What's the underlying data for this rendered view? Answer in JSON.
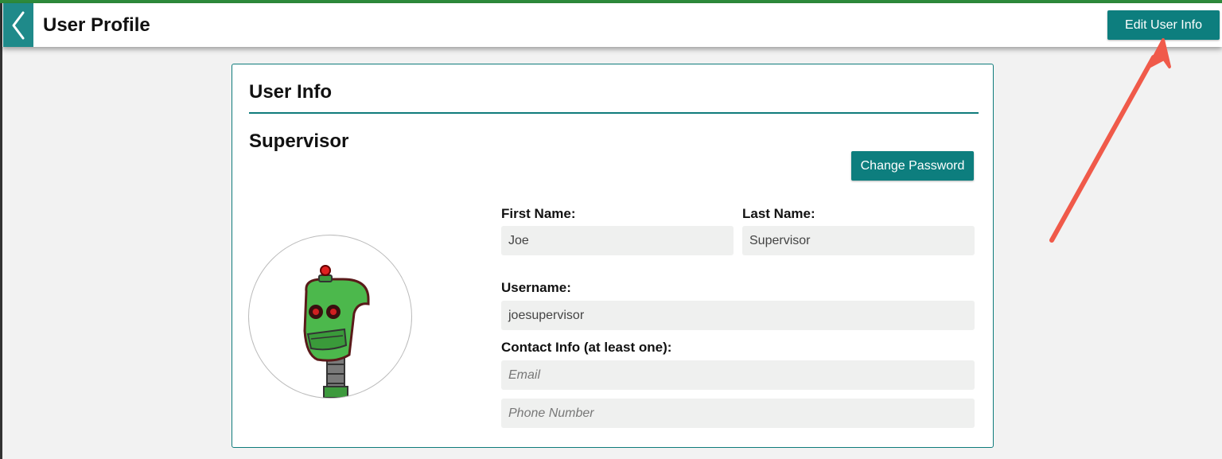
{
  "header": {
    "title": "User Profile",
    "edit_button_label": "Edit User Info",
    "back_icon": "chevron-left-icon"
  },
  "card": {
    "title": "User Info",
    "role": "Supervisor",
    "change_password_label": "Change Password",
    "avatar_icon": "robot-avatar",
    "fields": {
      "first_name": {
        "label": "First Name:",
        "value": "Joe"
      },
      "last_name": {
        "label": "Last Name:",
        "value": "Supervisor"
      },
      "username": {
        "label": "Username:",
        "value": "joesupervisor"
      },
      "contact_label": "Contact Info (at least one):",
      "email": {
        "placeholder": "Email"
      },
      "phone": {
        "placeholder": "Phone Number"
      }
    }
  },
  "colors": {
    "accent": "#0d7e7e",
    "top_strip": "#2e8b3c",
    "annotation_arrow": "#f05a4a"
  }
}
